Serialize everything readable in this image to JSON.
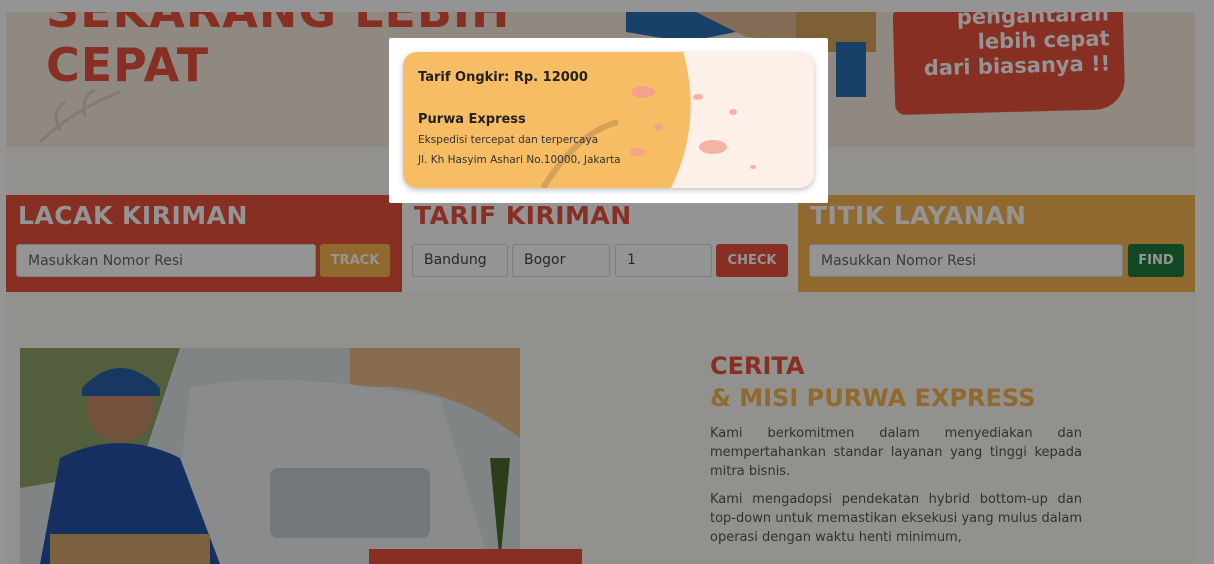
{
  "hero": {
    "top_text": "SEKARANG LEBIH",
    "title": "CEPAT",
    "badge_lines": [
      "pengantaran",
      "lebih cepat",
      "dari biasanya !!"
    ]
  },
  "lacak": {
    "title": "LACAK KIRIMAN",
    "placeholder": "Masukkan Nomor Resi",
    "button": "TRACK"
  },
  "tarif": {
    "title": "TARIF KIRIMAN",
    "origin": "Bandung",
    "destination": "Bogor",
    "weight": "1",
    "button": "CHECK"
  },
  "titik": {
    "title": "TITIK LAYANAN",
    "placeholder": "Masukkan Nomor Resi",
    "button": "FIND"
  },
  "story": {
    "title_line1": "CERITA",
    "title_line2": "& MISI PURWA EXPRESS",
    "paragraph1": "Kami berkomitmen dalam menyediakan dan mempertahankan standar layanan yang tinggi kepada mitra bisnis.",
    "paragraph2": "Kami mengadopsi pendekatan hybrid bottom-up dan top-down untuk memastikan eksekusi yang mulus dalam operasi dengan waktu henti minimum,"
  },
  "modal": {
    "tarif_text": "Tarif Ongkir: Rp. 12000",
    "company_name": "Purwa Express",
    "tagline": "Ekspedisi tercepat dan terpercaya",
    "address": "Jl. Kh Hasyim Ashari No.10000, Jakarta"
  },
  "colors": {
    "brand_red": "#e8513c",
    "brand_yellow": "#f6b650",
    "find_green": "#1f7a3f"
  }
}
